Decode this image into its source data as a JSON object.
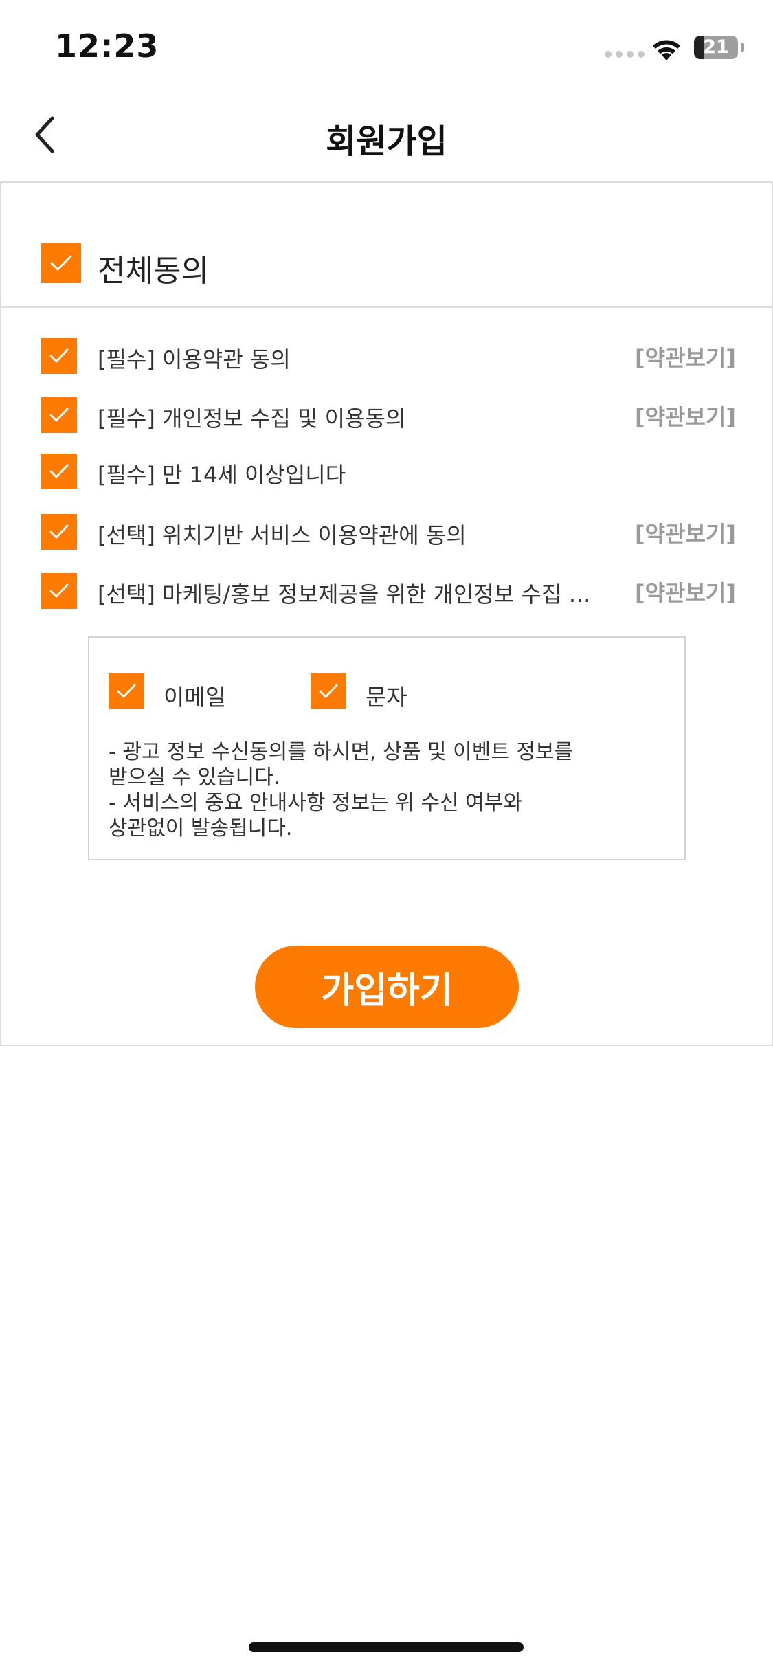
{
  "status_bar": {
    "time": "12:23",
    "battery_level": "21"
  },
  "header": {
    "title": "회원가입",
    "back_icon": "chevron-left-icon"
  },
  "colors": {
    "accent": "#ff7a00",
    "link_gray": "#9a9a9a",
    "border": "#dcdcdc"
  },
  "agree_all": {
    "label": "전체동의",
    "checked": true
  },
  "terms": [
    {
      "label": "[필수] 이용약관 동의",
      "checked": true,
      "view_label": "[약관보기]"
    },
    {
      "label": "[필수] 개인정보 수집 및 이용동의",
      "checked": true,
      "view_label": "[약관보기]"
    },
    {
      "label": "[필수] 만 14세 이상입니다",
      "checked": true,
      "view_label": ""
    },
    {
      "label": "[선택] 위치기반 서비스 이용약관에 동의",
      "checked": true,
      "view_label": "[약관보기]"
    },
    {
      "label": "[선택] 마케팅/홍보 정보제공을 위한 개인정보 수집 및 이용동의",
      "checked": true,
      "view_label": "[약관보기]"
    }
  ],
  "marketing": {
    "options": [
      {
        "label": "이메일",
        "checked": true
      },
      {
        "label": "문자",
        "checked": true
      }
    ],
    "notice_lines": [
      "- 광고 정보 수신동의를 하시면, 상품 및 이벤트 정보를\n받으실 수 있습니다.",
      "- 서비스의 중요 안내사항 정보는 위 수신 여부와\n상관없이 발송됩니다."
    ]
  },
  "submit_label": "가입하기"
}
